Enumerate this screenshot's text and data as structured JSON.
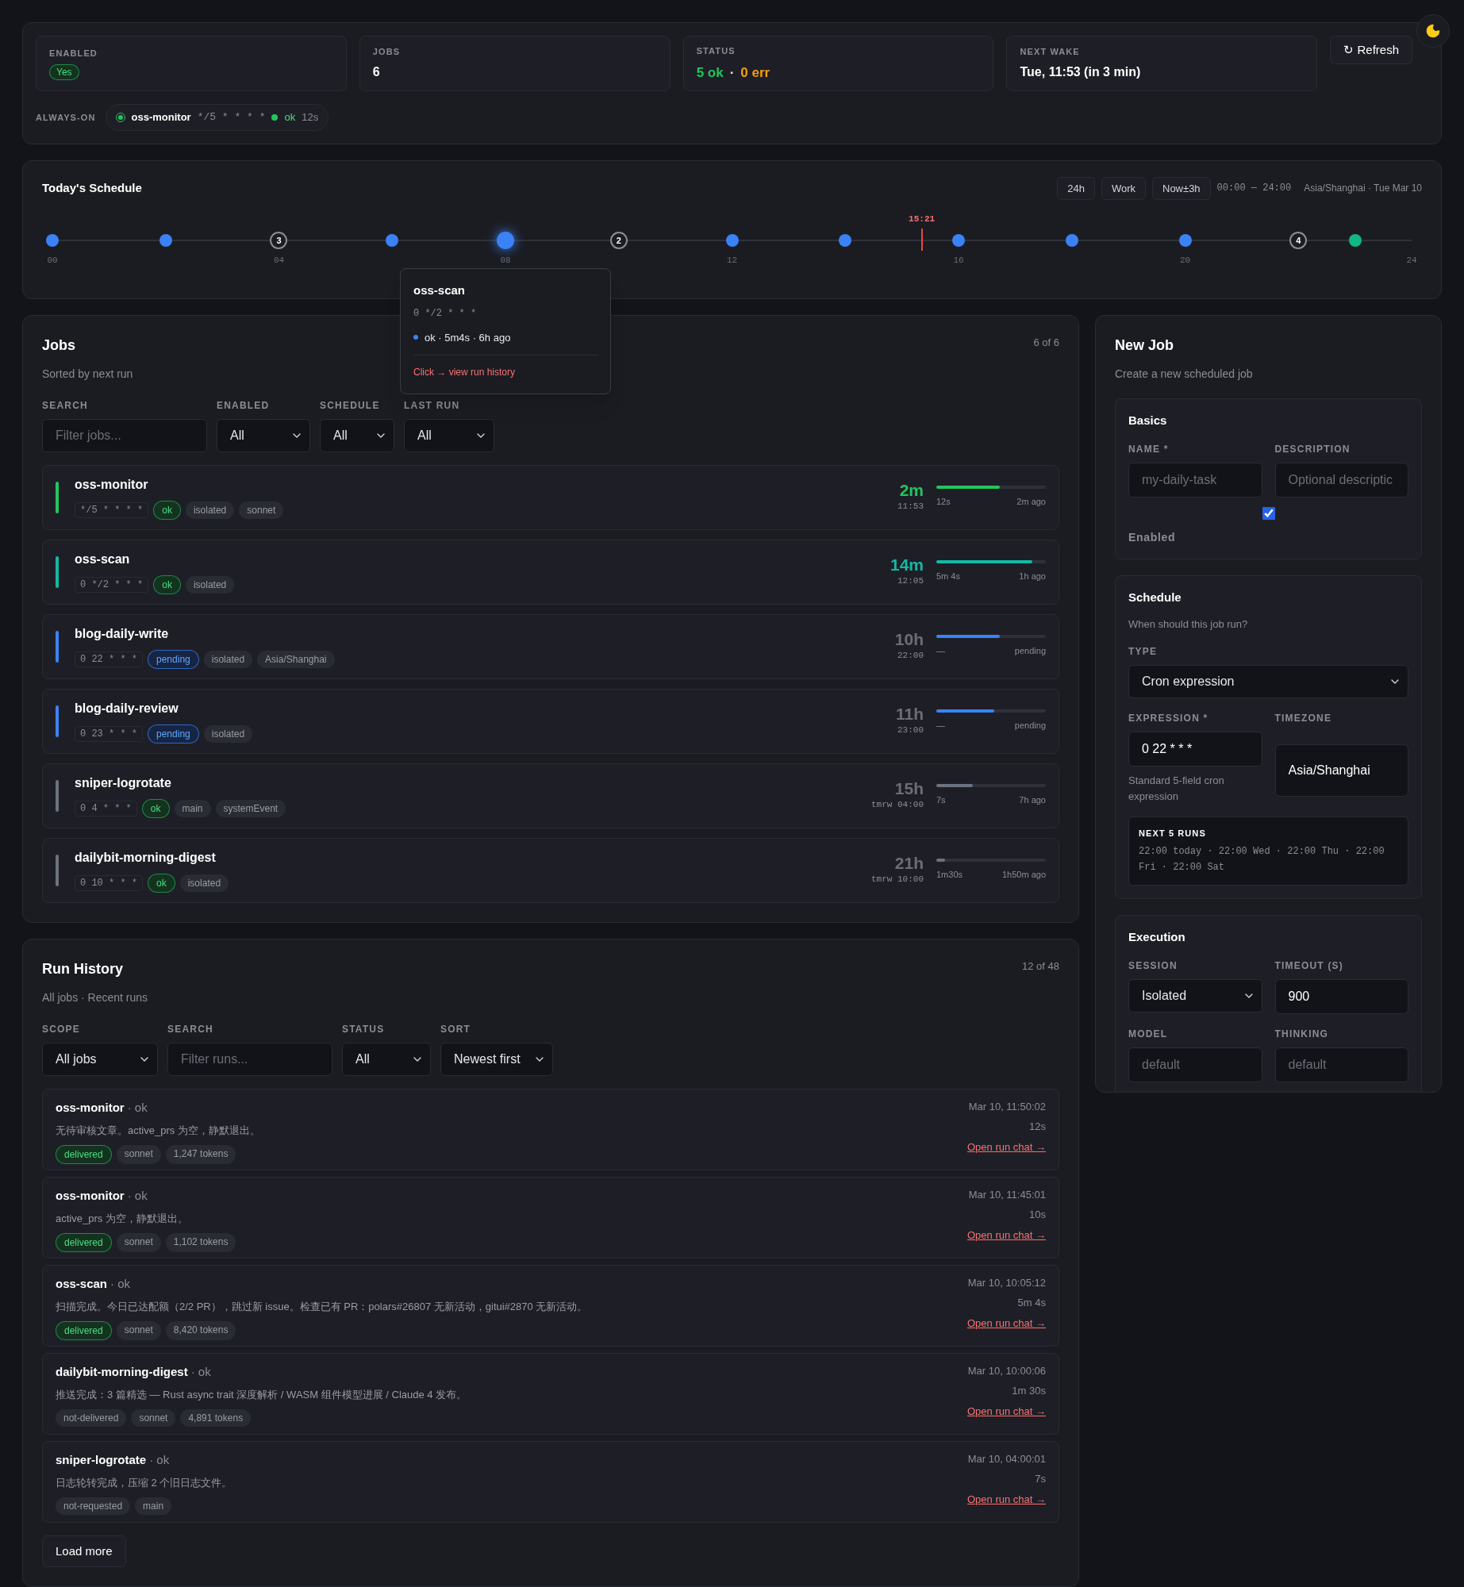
{
  "stats": [
    {
      "label": "ENABLED",
      "kind": "badge",
      "value": "Yes"
    },
    {
      "label": "JOBS",
      "kind": "plain",
      "value": "6"
    },
    {
      "label": "STATUS",
      "kind": "status",
      "ok": "5 ok",
      "sep": "·",
      "err": "0 err"
    },
    {
      "label": "NEXT WAKE",
      "kind": "plain",
      "value": "Tue, 11:53 (in 3 min)"
    }
  ],
  "refresh": {
    "icon": "↻",
    "label": "Refresh"
  },
  "always_on": {
    "label": "ALWAYS-ON",
    "name": "oss-monitor",
    "cron": "*/5 * * * *",
    "status": "ok",
    "duration": "12s"
  },
  "schedule": {
    "title": "Today's Schedule",
    "views": [
      {
        "label": "24h",
        "selected": false
      },
      {
        "label": "Work",
        "selected": false
      },
      {
        "label": "Now±3h",
        "selected": false
      }
    ],
    "range": "00:00 — 24:00",
    "zone": "Asia/Shanghai · Tue Mar 10",
    "slots": [
      {
        "kind": "run",
        "color": "#3b82f6",
        "selected": false
      },
      {
        "kind": "empty"
      },
      {
        "kind": "run",
        "color": "#3b82f6",
        "selected": false
      },
      {
        "kind": "empty"
      },
      {
        "kind": "group",
        "count": "3"
      },
      {
        "kind": "empty"
      },
      {
        "kind": "run",
        "color": "#3b82f6",
        "selected": false
      },
      {
        "kind": "empty"
      },
      {
        "kind": "run",
        "color": "#3b82f6",
        "selected": true
      },
      {
        "kind": "empty"
      },
      {
        "kind": "group",
        "count": "2"
      },
      {
        "kind": "empty"
      },
      {
        "kind": "run",
        "color": "#3b82f6",
        "selected": false
      },
      {
        "kind": "empty"
      },
      {
        "kind": "run",
        "color": "#3b82f6",
        "selected": false
      },
      {
        "kind": "empty"
      },
      {
        "kind": "run",
        "color": "#3b82f6",
        "selected": false
      },
      {
        "kind": "empty"
      },
      {
        "kind": "run",
        "color": "#3b82f6",
        "selected": false
      },
      {
        "kind": "empty"
      },
      {
        "kind": "run",
        "color": "#3b82f6",
        "selected": false
      },
      {
        "kind": "empty"
      },
      {
        "kind": "group",
        "count": "4"
      },
      {
        "kind": "run",
        "color": "#10b981",
        "selected": false
      }
    ],
    "ticks": [
      "00",
      "04",
      "08",
      "12",
      "16",
      "20",
      "24"
    ],
    "now": {
      "label": "15:21",
      "level": 0.6396
    },
    "tooltip": {
      "name": "oss-scan",
      "cron": "0 */2 * * *",
      "status": "ok · 5m4s · 6h ago",
      "link": "Click → view run history"
    }
  },
  "jobs": {
    "title": "Jobs",
    "subtitle": "Sorted by next run",
    "count": "6 of 6",
    "filters": [
      {
        "label": "SEARCH",
        "kind": "input",
        "placeholder": "Filter jobs..."
      },
      {
        "label": "ENABLED",
        "kind": "select",
        "value": "All"
      },
      {
        "label": "SCHEDULE",
        "kind": "select",
        "value": "All"
      },
      {
        "label": "LAST RUN",
        "kind": "select",
        "value": "All"
      }
    ],
    "rows": [
      {
        "name": "oss-monitor",
        "cron": "*/5 * * * *",
        "tags": [
          {
            "kind": "ok",
            "text": "ok"
          },
          {
            "kind": "plain",
            "text": "isolated"
          },
          {
            "kind": "plain",
            "text": "sonnet"
          }
        ],
        "color": "#22c55e",
        "highlight": true,
        "countdown": "2m",
        "time": "11:53",
        "level": 0.58,
        "duration": "12s",
        "last": "2m ago"
      },
      {
        "name": "oss-scan",
        "cron": "0 */2 * * *",
        "tags": [
          {
            "kind": "ok",
            "text": "ok"
          },
          {
            "kind": "plain",
            "text": "isolated"
          }
        ],
        "color": "#14b8a6",
        "highlight": true,
        "countdown": "14m",
        "time": "12:05",
        "level": 0.88,
        "duration": "5m 4s",
        "last": "1h ago"
      },
      {
        "name": "blog-daily-write",
        "cron": "0 22 * * *",
        "tags": [
          {
            "kind": "pending",
            "text": "pending"
          },
          {
            "kind": "plain",
            "text": "isolated"
          },
          {
            "kind": "plain",
            "text": "Asia/Shanghai"
          }
        ],
        "color": "#3b82f6",
        "highlight": false,
        "countdown": "10h",
        "time": "22:00",
        "level": 0.58,
        "duration": "—",
        "last": "pending"
      },
      {
        "name": "blog-daily-review",
        "cron": "0 23 * * *",
        "tags": [
          {
            "kind": "pending",
            "text": "pending"
          },
          {
            "kind": "plain",
            "text": "isolated"
          }
        ],
        "color": "#3b82f6",
        "highlight": false,
        "countdown": "11h",
        "time": "23:00",
        "level": 0.53,
        "duration": "—",
        "last": "pending"
      },
      {
        "name": "sniper-logrotate",
        "cron": "0 4 * * *",
        "tags": [
          {
            "kind": "ok",
            "text": "ok"
          },
          {
            "kind": "plain",
            "text": "main"
          },
          {
            "kind": "plain",
            "text": "systemEvent"
          }
        ],
        "color": "#6b7280",
        "highlight": false,
        "countdown": "15h",
        "time": "tmrw 04:00",
        "level": 0.33,
        "duration": "7s",
        "last": "7h ago"
      },
      {
        "name": "dailybit-morning-digest",
        "cron": "0 10 * * *",
        "tags": [
          {
            "kind": "ok",
            "text": "ok"
          },
          {
            "kind": "plain",
            "text": "isolated"
          }
        ],
        "color": "#6b7280",
        "highlight": false,
        "countdown": "21h",
        "time": "tmrw 10:00",
        "level": 0.08,
        "duration": "1m30s",
        "last": "1h50m ago"
      }
    ]
  },
  "history": {
    "title": "Run History",
    "subtitle": "All jobs · Recent runs",
    "count": "12 of 48",
    "filters": [
      {
        "label": "SCOPE",
        "kind": "select",
        "value": "All jobs"
      },
      {
        "label": "SEARCH",
        "kind": "input",
        "placeholder": "Filter runs..."
      },
      {
        "label": "STATUS",
        "kind": "select",
        "value": "All"
      },
      {
        "label": "SORT",
        "kind": "select",
        "value": "Newest first"
      }
    ],
    "runs": [
      {
        "name": "oss-monitor",
        "status": "· ok",
        "message": "无待审核文章。active_prs 为空，静默退出。",
        "tags": [
          {
            "kind": "delivered",
            "text": "delivered"
          },
          {
            "kind": "plain",
            "text": "sonnet"
          },
          {
            "kind": "plain",
            "text": "1,247 tokens"
          }
        ],
        "time": "Mar 10, 11:50:02",
        "duration": "12s",
        "link": "Open run chat →"
      },
      {
        "name": "oss-monitor",
        "status": "· ok",
        "message": "active_prs 为空，静默退出。",
        "tags": [
          {
            "kind": "delivered",
            "text": "delivered"
          },
          {
            "kind": "plain",
            "text": "sonnet"
          },
          {
            "kind": "plain",
            "text": "1,102 tokens"
          }
        ],
        "time": "Mar 10, 11:45:01",
        "duration": "10s",
        "link": "Open run chat →"
      },
      {
        "name": "oss-scan",
        "status": "· ok",
        "message": "扫描完成。今日已达配额（2/2 PR），跳过新 issue。检查已有 PR：polars#26807 无新活动，gitui#2870 无新活动。",
        "tags": [
          {
            "kind": "delivered",
            "text": "delivered"
          },
          {
            "kind": "plain",
            "text": "sonnet"
          },
          {
            "kind": "plain",
            "text": "8,420 tokens"
          }
        ],
        "time": "Mar 10, 10:05:12",
        "duration": "5m 4s",
        "link": "Open run chat →"
      },
      {
        "name": "dailybit-morning-digest",
        "status": "· ok",
        "message": "推送完成：3 篇精选 — Rust async trait 深度解析 / WASM 组件模型进展 / Claude 4 发布。",
        "tags": [
          {
            "kind": "plain",
            "text": "not-delivered"
          },
          {
            "kind": "plain",
            "text": "sonnet"
          },
          {
            "kind": "plain",
            "text": "4,891 tokens"
          }
        ],
        "time": "Mar 10, 10:00:06",
        "duration": "1m 30s",
        "link": "Open run chat →"
      },
      {
        "name": "sniper-logrotate",
        "status": "· ok",
        "message": "日志轮转完成，压缩 2 个旧日志文件。",
        "tags": [
          {
            "kind": "plain",
            "text": "not-requested"
          },
          {
            "kind": "plain",
            "text": "main"
          }
        ],
        "time": "Mar 10, 04:00:01",
        "duration": "7s",
        "link": "Open run chat →"
      }
    ],
    "load_more": "Load more"
  },
  "new_job": {
    "title": "New Job",
    "subtitle": "Create a new scheduled job",
    "basics": {
      "title": "Basics",
      "name_label": "NAME *",
      "name_placeholder": "my-daily-task",
      "desc_label": "DESCRIPTION",
      "desc_placeholder": "Optional descriptic",
      "enabled_label": "Enabled",
      "enabled": true
    },
    "schedule": {
      "title": "Schedule",
      "subtitle": "When should this job run?",
      "type_label": "TYPE",
      "type": "Cron expression",
      "expr_label": "EXPRESSION *",
      "expr": "0 22 * * *",
      "expr_help": "Standard 5-field cron expression",
      "tz_label": "TIMEZONE",
      "tz": "Asia/Shanghai",
      "next_label": "NEXT 5 RUNS",
      "next": "22:00 today · 22:00 Wed · 22:00 Thu · 22:00 Fri · 22:00 Sat"
    },
    "execution": {
      "title": "Execution",
      "session_label": "SESSION",
      "session": "Isolated",
      "timeout_label": "TIMEOUT (S)",
      "timeout": "900",
      "model_label": "MODEL",
      "model_placeholder": "default",
      "thinking_label": "THINKING",
      "thinking_placeholder": "default"
    }
  }
}
